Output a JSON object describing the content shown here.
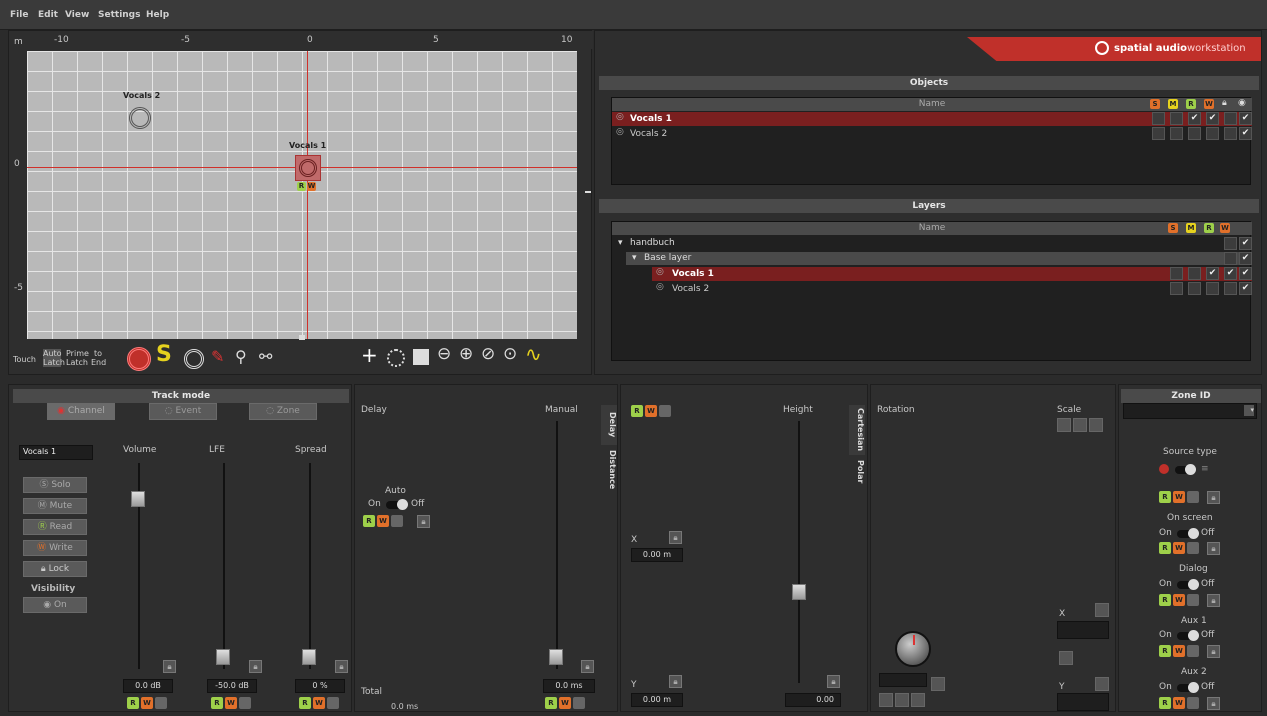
{
  "menu": [
    "File",
    "Edit",
    "View",
    "Settings",
    "Help"
  ],
  "ruler": {
    "unit": "m",
    "h": [
      "-10",
      "-5",
      "0",
      "5",
      "10"
    ],
    "v": [
      "0",
      "-5"
    ]
  },
  "canvas": {
    "obj1": "Vocals 1",
    "obj2": "Vocals 2"
  },
  "toolbar": {
    "touch": "Touch",
    "auto_latch": "Auto Latch",
    "latch": "Latch",
    "prime_latch": "Prime Latch",
    "to_end": "to End"
  },
  "brand": {
    "name": "spatial audio",
    "suffix": "workstation"
  },
  "objects": {
    "title": "Objects",
    "col": "Name",
    "rows": [
      "Vocals 1",
      "Vocals 2"
    ]
  },
  "layers": {
    "title": "Layers",
    "col": "Name",
    "root": "handbuch",
    "base": "Base layer",
    "rows": [
      "Vocals 1",
      "Vocals 2"
    ]
  },
  "track_mode": {
    "title": "Track mode",
    "channel": "Channel",
    "event": "Event",
    "zone": "Zone"
  },
  "channel": {
    "name": "Vocals 1",
    "solo": "Solo",
    "mute": "Mute",
    "read": "Read",
    "write": "Write",
    "lock": "Lock",
    "visibility": "Visibility",
    "vis_on": "On",
    "volume": "Volume",
    "lfe": "LFE",
    "spread": "Spread",
    "volume_val": "0.0 dB",
    "lfe_val": "-50.0 dB",
    "spread_val": "0 %"
  },
  "delay": {
    "title": "Delay",
    "manual": "Manual",
    "auto": "Auto",
    "on": "On",
    "off": "Off",
    "total": "Total",
    "total_val": "0.0 ms",
    "manual_val": "0.0 ms",
    "tab_delay": "Delay",
    "tab_distance": "Distance"
  },
  "position": {
    "height": "Height",
    "x": "X",
    "y": "Y",
    "x_val": "0.00 m",
    "y_val": "0.00 m",
    "height_val": "0.00",
    "tab_cartesian": "Cartesian",
    "tab_polar": "Polar"
  },
  "rotation": {
    "title": "Rotation",
    "scale": "Scale",
    "x": "X",
    "y": "Y"
  },
  "zone": {
    "title": "Zone ID",
    "source_type": "Source type",
    "on_screen": "On screen",
    "dialog": "Dialog",
    "aux1": "Aux 1",
    "aux2": "Aux 2",
    "on": "On",
    "off": "Off"
  },
  "colors": {
    "accent_red": "#c0302a",
    "row_sel": "#7a1f1f",
    "green": "#9ed04a",
    "orange": "#e1702a"
  }
}
